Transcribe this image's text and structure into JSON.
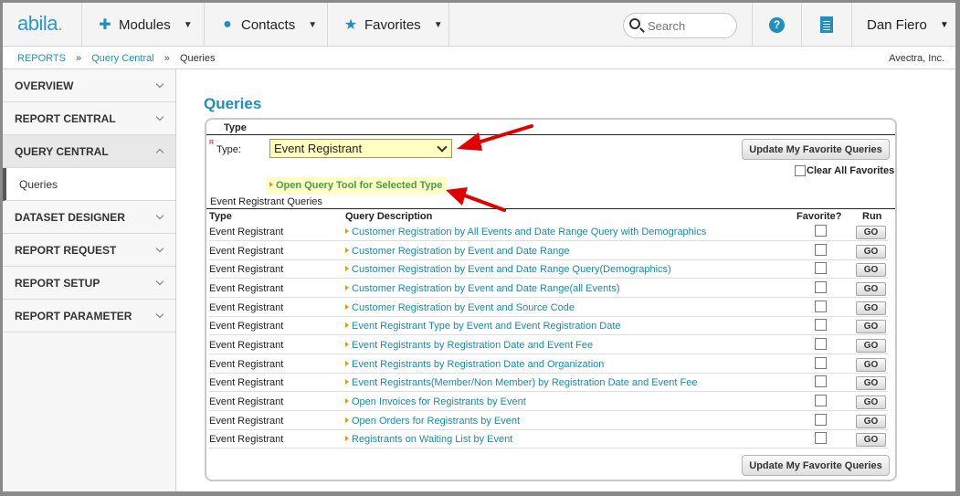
{
  "header": {
    "logo": "abila",
    "logo_dot": ".",
    "nav": [
      {
        "label": "Modules"
      },
      {
        "label": "Contacts"
      },
      {
        "label": "Favorites"
      }
    ],
    "search_placeholder": "Search",
    "user": "Dan Fiero"
  },
  "breadcrumb": {
    "items": [
      "REPORTS",
      "Query Central"
    ],
    "separator": "»",
    "current": "Queries",
    "company": "Avectra, Inc."
  },
  "sidebar": {
    "items": [
      {
        "label": "OVERVIEW"
      },
      {
        "label": "REPORT CENTRAL"
      },
      {
        "label": "QUERY CENTRAL"
      },
      {
        "label": "DATASET DESIGNER"
      },
      {
        "label": "REPORT REQUEST"
      },
      {
        "label": "REPORT SETUP"
      },
      {
        "label": "REPORT PARAMETER"
      }
    ],
    "sub_item": "Queries"
  },
  "main": {
    "title": "Queries",
    "section_title": "Type",
    "required_mark": "R",
    "type_label": "Type:",
    "type_value": "Event Registrant",
    "update_button": "Update My Favorite Queries",
    "clear_favorites": "Clear All Favorites",
    "open_tool": "Open Query Tool for Selected Type",
    "queries_heading": "Event Registrant Queries",
    "columns": {
      "type": "Type",
      "desc": "Query Description",
      "fav": "Favorite?",
      "run": "Run"
    },
    "go_label": "GO",
    "rows": [
      {
        "type": "Event Registrant",
        "desc": "Customer Registration by All Events and Date Range Query with Demographics"
      },
      {
        "type": "Event Registrant",
        "desc": "Customer Registration by Event and Date Range"
      },
      {
        "type": "Event Registrant",
        "desc": "Customer Registration by Event and Date Range Query(Demographics)"
      },
      {
        "type": "Event Registrant",
        "desc": "Customer Registration by Event and Date Range(all Events)"
      },
      {
        "type": "Event Registrant",
        "desc": "Customer Registration by Event and Source Code"
      },
      {
        "type": "Event Registrant",
        "desc": "Event Registrant Type by Event and Event Registration Date"
      },
      {
        "type": "Event Registrant",
        "desc": "Event Registrants by Registration Date and Event Fee"
      },
      {
        "type": "Event Registrant",
        "desc": "Event Registrants by Registration Date and Organization"
      },
      {
        "type": "Event Registrant",
        "desc": "Event Registrants(Member/Non Member) by Registration Date and Event Fee"
      },
      {
        "type": "Event Registrant",
        "desc": "Open Invoices for Registrants by Event"
      },
      {
        "type": "Event Registrant",
        "desc": "Open Orders for Registrants by Event"
      },
      {
        "type": "Event Registrant",
        "desc": "Registrants on Waiting List by Event"
      }
    ]
  },
  "colors": {
    "accent": "#1f8fbf",
    "link": "#1a8aa8",
    "highlight": "#ffffc2",
    "arrow": "#e00000"
  }
}
